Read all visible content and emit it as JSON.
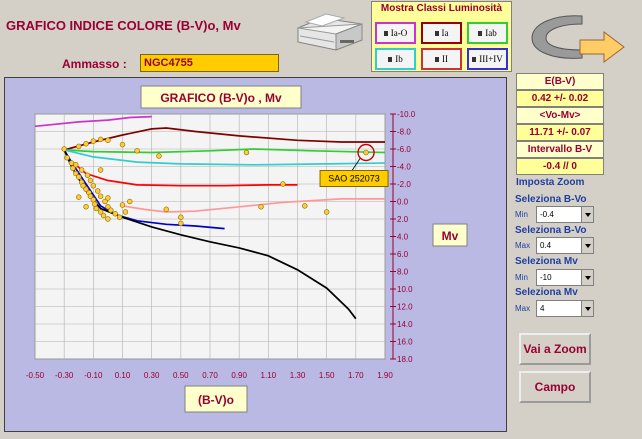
{
  "header": {
    "title": "GRAFICO INDICE COLORE (B-V)o, Mv",
    "ammasso_label": "Ammasso :",
    "ammasso_value": "NGC4755"
  },
  "luminosity_panel": {
    "title": "Mostra Classi Luminosità",
    "buttons": [
      {
        "label": "Ia-O",
        "border": "#cc33cc"
      },
      {
        "label": "Ia",
        "border": "#990000"
      },
      {
        "label": "Iab",
        "border": "#33cc33"
      },
      {
        "label": "Ib",
        "border": "#33cccc"
      },
      {
        "label": "II",
        "border": "#cc3333"
      },
      {
        "label": "III+IV",
        "border": "#3333cc"
      }
    ]
  },
  "icons": {
    "printer": "printer-icon",
    "back_arrow": "back-arrow-icon"
  },
  "chart_data": {
    "type": "scatter",
    "title": "GRAFICO (B-V)o , Mv",
    "xlabel": "(B-V)o",
    "ylabel": "Mv",
    "xlim": [
      -0.5,
      1.9
    ],
    "ylim": [
      -10,
      18
    ],
    "y_inverted": true,
    "grid": true,
    "x_ticks": [
      "-0.50",
      "-0.30",
      "-0.10",
      "0.10",
      "0.30",
      "0.50",
      "0.70",
      "0.90",
      "1.10",
      "1.30",
      "1.50",
      "1.70",
      "1.90"
    ],
    "y_ticks": [
      "-10.0",
      "-8.0",
      "-6.0",
      "-4.0",
      "-2.0",
      "0.0",
      "2.0",
      "4.0",
      "6.0",
      "8.0",
      "10.0",
      "12.0",
      "14.0",
      "16.0",
      "18.0"
    ],
    "series": [
      {
        "color": "#cc33cc",
        "points": [
          [
            -0.5,
            -8.6
          ],
          [
            -0.2,
            -9.1
          ],
          [
            0.0,
            -9.3
          ],
          [
            0.15,
            -9.6
          ],
          [
            0.3,
            -9.7
          ]
        ]
      },
      {
        "color": "#800000",
        "points": [
          [
            -0.3,
            -5.9
          ],
          [
            -0.1,
            -6.8
          ],
          [
            0.1,
            -7.6
          ],
          [
            0.3,
            -8.3
          ],
          [
            0.4,
            -8.4
          ],
          [
            0.6,
            -8.0
          ],
          [
            0.9,
            -7.5
          ],
          [
            1.3,
            -7.0
          ],
          [
            1.6,
            -6.8
          ],
          [
            1.9,
            -6.8
          ]
        ]
      },
      {
        "color": "#33cc33",
        "points": [
          [
            -0.3,
            -5.9
          ],
          [
            -0.1,
            -5.7
          ],
          [
            0.3,
            -5.6
          ],
          [
            0.7,
            -5.8
          ],
          [
            1.0,
            -6.0
          ],
          [
            1.4,
            -5.8
          ],
          [
            1.9,
            -5.6
          ]
        ]
      },
      {
        "color": "#33cccc",
        "points": [
          [
            -0.3,
            -5.9
          ],
          [
            -0.1,
            -5.1
          ],
          [
            0.2,
            -4.5
          ],
          [
            0.5,
            -4.3
          ],
          [
            1.0,
            -4.2
          ],
          [
            1.5,
            -4.3
          ],
          [
            1.9,
            -4.4
          ]
        ]
      },
      {
        "color": "#ff0000",
        "points": [
          [
            -0.25,
            -4.6
          ],
          [
            -0.15,
            -3.2
          ],
          [
            0.0,
            -2.4
          ],
          [
            0.2,
            -1.9
          ],
          [
            0.5,
            -1.8
          ],
          [
            0.8,
            -1.8
          ],
          [
            1.1,
            -1.9
          ],
          [
            1.3,
            -1.9
          ]
        ]
      },
      {
        "color": "#ff9999",
        "points": [
          [
            0.1,
            0.5
          ],
          [
            0.25,
            0.9
          ],
          [
            0.4,
            1.2
          ],
          [
            0.6,
            1.1
          ],
          [
            0.9,
            0.6
          ],
          [
            1.2,
            0.1
          ],
          [
            1.6,
            -0.3
          ],
          [
            1.9,
            -0.3
          ]
        ]
      },
      {
        "color": "#0000cc",
        "points": [
          [
            -0.3,
            -5.9
          ],
          [
            -0.25,
            -4.5
          ],
          [
            -0.15,
            -2.0
          ],
          [
            -0.05,
            0.5
          ],
          [
            0.05,
            1.5
          ],
          [
            0.2,
            2.2
          ],
          [
            0.4,
            2.6
          ],
          [
            0.6,
            2.8
          ],
          [
            0.8,
            3.1
          ]
        ]
      },
      {
        "color": "#000000",
        "points": [
          [
            -0.3,
            -5.9
          ],
          [
            -0.25,
            -4.0
          ],
          [
            -0.15,
            -1.2
          ],
          [
            -0.05,
            0.8
          ],
          [
            0.1,
            1.8
          ],
          [
            0.3,
            2.9
          ],
          [
            0.5,
            3.8
          ],
          [
            0.7,
            4.6
          ],
          [
            0.9,
            5.3
          ],
          [
            1.1,
            6.2
          ],
          [
            1.3,
            7.8
          ],
          [
            1.5,
            9.9
          ],
          [
            1.65,
            12.3
          ],
          [
            1.7,
            13.4
          ]
        ]
      }
    ],
    "stars": [
      [
        -0.3,
        -6.0
      ],
      [
        -0.2,
        -6.3
      ],
      [
        -0.15,
        -6.6
      ],
      [
        -0.1,
        -6.9
      ],
      [
        -0.05,
        -7.1
      ],
      [
        0.0,
        -7.0
      ],
      [
        0.1,
        -6.5
      ],
      [
        0.2,
        -5.8
      ],
      [
        0.35,
        -5.2
      ],
      [
        -0.28,
        -5.0
      ],
      [
        -0.25,
        -4.4
      ],
      [
        -0.24,
        -3.8
      ],
      [
        -0.22,
        -3.2
      ],
      [
        -0.2,
        -2.8
      ],
      [
        -0.18,
        -2.2
      ],
      [
        -0.17,
        -1.8
      ],
      [
        -0.15,
        -1.4
      ],
      [
        -0.13,
        -1.0
      ],
      [
        -0.12,
        -0.6
      ],
      [
        -0.1,
        -0.2
      ],
      [
        -0.09,
        0.3
      ],
      [
        -0.08,
        0.8
      ],
      [
        -0.05,
        1.2
      ],
      [
        -0.03,
        1.6
      ],
      [
        0.0,
        2.0
      ],
      [
        -0.22,
        -4.2
      ],
      [
        -0.18,
        -3.6
      ],
      [
        -0.14,
        -3.0
      ],
      [
        -0.12,
        -2.4
      ],
      [
        -0.1,
        -1.8
      ],
      [
        -0.07,
        -1.2
      ],
      [
        -0.05,
        -0.6
      ],
      [
        -0.02,
        0.0
      ],
      [
        0.0,
        0.6
      ],
      [
        0.02,
        1.0
      ],
      [
        0.05,
        1.4
      ],
      [
        0.08,
        1.8
      ],
      [
        0.1,
        0.4
      ],
      [
        0.12,
        1.2
      ],
      [
        -0.2,
        -0.5
      ],
      [
        -0.15,
        0.6
      ],
      [
        0.0,
        -0.4
      ],
      [
        -0.05,
        -3.6
      ],
      [
        0.15,
        0.0
      ],
      [
        0.4,
        0.9
      ],
      [
        0.5,
        1.8
      ],
      [
        0.5,
        2.5
      ],
      [
        1.05,
        0.6
      ],
      [
        1.2,
        -2.0
      ],
      [
        1.35,
        0.5
      ],
      [
        1.5,
        1.2
      ],
      [
        1.77,
        -5.6
      ],
      [
        0.95,
        -5.6
      ]
    ],
    "highlight": {
      "label": "SAO 252073",
      "x": 1.77,
      "y": -5.6
    }
  },
  "right_panel": {
    "ebv_label": "E(B-V)",
    "ebv_value": "0.42 +/- 0.02",
    "vomv_label": "<Vo-Mv>",
    "vomv_value": "11.71 +/- 0.07",
    "interval_label": "Intervallo B-V",
    "interval_value": "-0.4  //  0",
    "zoom_title": "Imposta Zoom",
    "sel_bv_1": "Seleziona B-Vo",
    "min_label": "Min",
    "min_bv": "-0.4",
    "sel_bv_2": "Seleziona B-Vo",
    "max_label": "Max",
    "max_bv": "0.4",
    "sel_mv_1": "Seleziona Mv",
    "min_mv": "-10",
    "sel_mv_2": "Seleziona Mv",
    "max_mv": "4",
    "zoom_button": "Vai a Zoom",
    "field_button": "Campo"
  }
}
